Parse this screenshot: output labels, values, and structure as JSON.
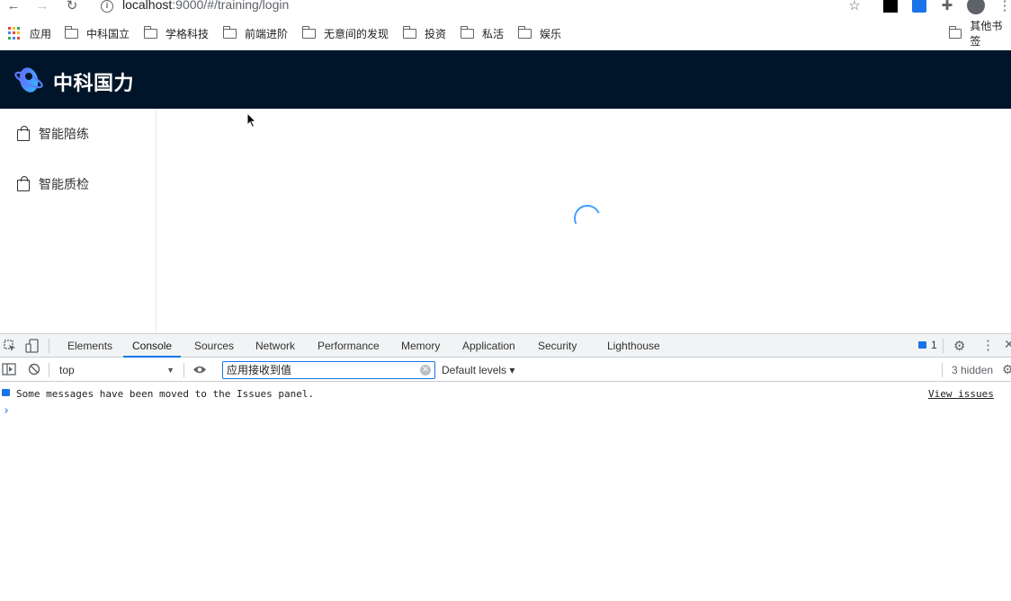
{
  "browser": {
    "url_host": "localhost",
    "url_path": ":9000/#/training/login",
    "bookmarks": [
      {
        "label": "应用",
        "icon": "apps-grid-icon"
      },
      {
        "label": "中科国立",
        "icon": "folder-icon"
      },
      {
        "label": "学格科技",
        "icon": "folder-icon"
      },
      {
        "label": "前端进阶",
        "icon": "folder-icon"
      },
      {
        "label": "无意间的发现",
        "icon": "folder-icon"
      },
      {
        "label": "投资",
        "icon": "folder-icon"
      },
      {
        "label": "私活",
        "icon": "folder-icon"
      },
      {
        "label": "娱乐",
        "icon": "folder-icon"
      },
      {
        "label": "其他书签",
        "icon": "folder-icon"
      }
    ]
  },
  "app": {
    "title": "中科国力",
    "header_color": "#001529",
    "menu": [
      {
        "label": "智能陪练",
        "icon": "shopping-bag-icon"
      },
      {
        "label": "智能质检",
        "icon": "shopping-bag-icon"
      }
    ],
    "loading": true,
    "spinner_color": "#409eff"
  },
  "devtools": {
    "tabs": [
      "Elements",
      "Console",
      "Sources",
      "Network",
      "Performance",
      "Memory",
      "Application",
      "Security",
      "Lighthouse"
    ],
    "active_tab": "Console",
    "issues_count": "1",
    "context": "top",
    "filter_value": "应用接收到值",
    "levels": "Default levels ▾",
    "hidden": "3 hidden",
    "messages": [
      {
        "text": "Some messages have been moved to the Issues panel.",
        "link": "View issues"
      }
    ],
    "prompt": "›",
    "accent": "#1a73e8"
  }
}
